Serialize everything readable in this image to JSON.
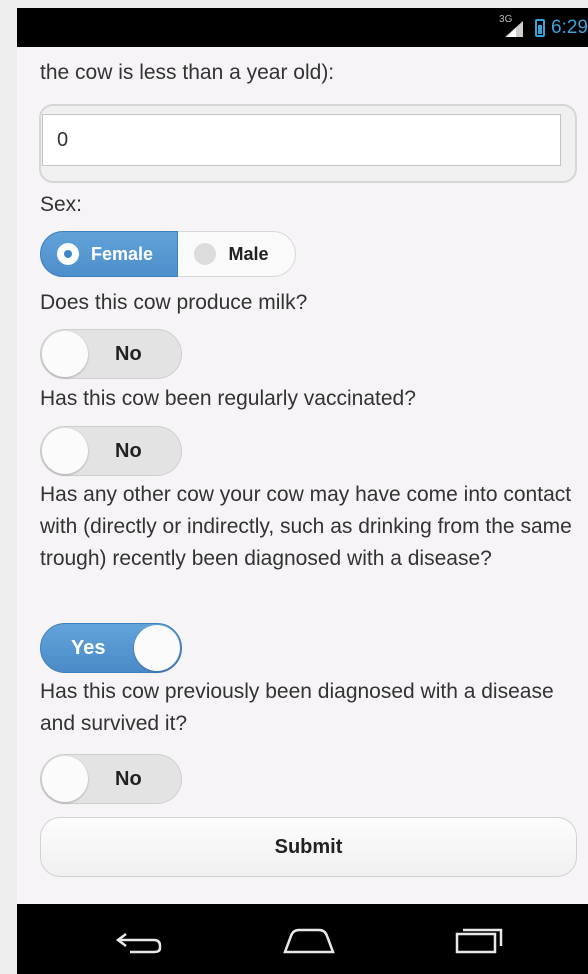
{
  "status_bar": {
    "network": "3G",
    "time": "6:29"
  },
  "form": {
    "age_label_tail": "the cow is less than a year old):",
    "age_value": "0",
    "sex_label": "Sex:",
    "sex_options": [
      "Female",
      "Male"
    ],
    "sex_selected": "Female",
    "milk_label": "Does this cow produce milk?",
    "milk_value": "No",
    "vaccinated_label": "Has this cow been regularly vaccinated?",
    "vaccinated_value": "No",
    "contact_label": "Has any other cow your cow may have come into contact with (directly or indirectly, such as drinking from the same trough) recently been diagnosed with a disease?",
    "contact_value": "Yes",
    "survived_label": "Has this cow previously been diagnosed with a disease and survived it?",
    "survived_value": "No",
    "submit_label": "Submit"
  },
  "nav": {
    "icons": [
      "back-icon",
      "home-icon",
      "recents-icon"
    ]
  },
  "colors": {
    "accent": "#4d8fcb",
    "status_accent": "#3aa3d8",
    "background": "#f6f4f6"
  }
}
